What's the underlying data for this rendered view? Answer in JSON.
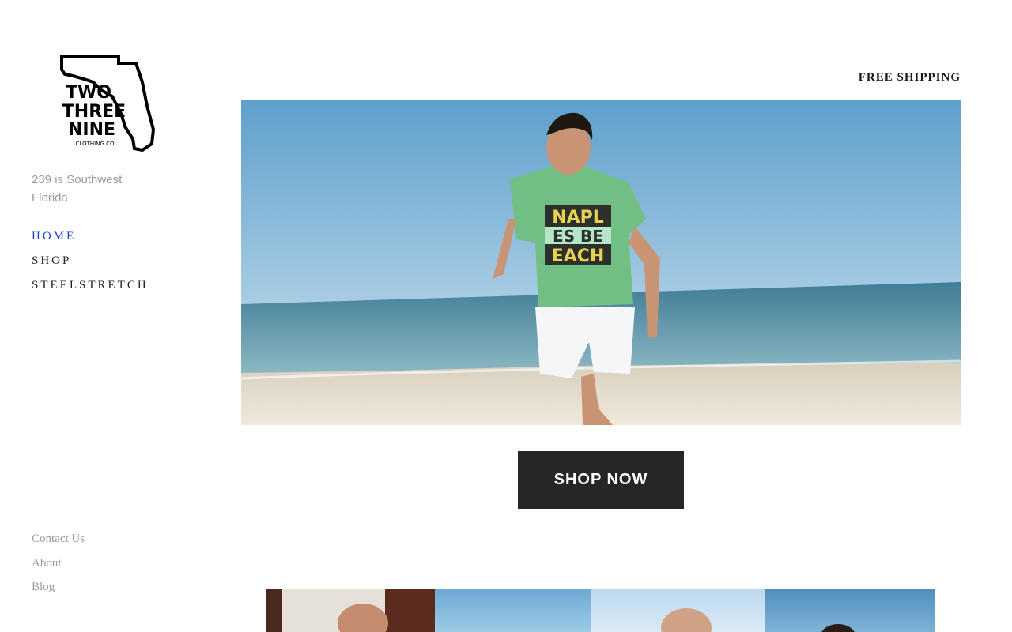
{
  "brand": {
    "logo_text": [
      "TWO",
      "THREE",
      "NINE",
      "CLOTHING CO"
    ],
    "tagline": "239 is Southwest Florida"
  },
  "nav": {
    "items": [
      {
        "label": "HOME",
        "active": true
      },
      {
        "label": "SHOP",
        "active": false
      },
      {
        "label": "STEELSTRETCH",
        "active": false
      }
    ]
  },
  "footer_nav": {
    "items": [
      "Contact Us",
      "About",
      "Blog"
    ]
  },
  "announcement": "FREE SHIPPING",
  "hero": {
    "shirt_text": [
      "NAPL",
      "ES BE",
      "EACH"
    ]
  },
  "cta": {
    "label": "SHOP NOW"
  },
  "gallery": {
    "count": 4
  },
  "colors": {
    "accent_nav": "#1c3fd9",
    "button_bg": "#262626",
    "muted_text": "#9a9a9a"
  }
}
